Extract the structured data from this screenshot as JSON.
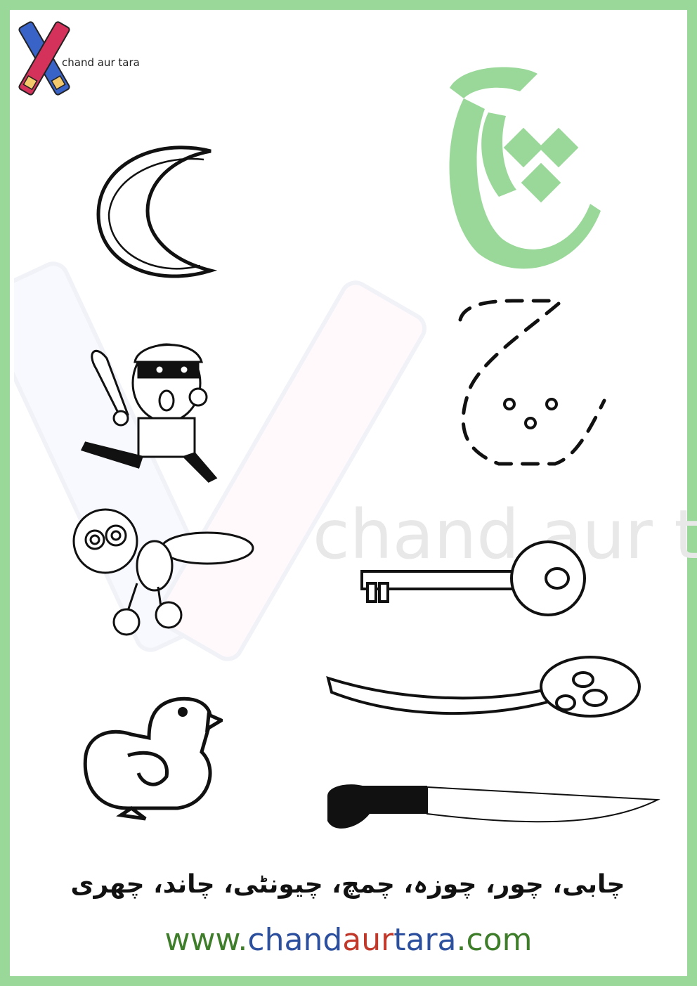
{
  "brand": {
    "name": "chand aur tara",
    "icon": "crossed-pencils-icon"
  },
  "watermark": {
    "text": "chand aur t"
  },
  "letter": {
    "glyph": "چ",
    "color": "#99d899"
  },
  "trace": {
    "glyph": "چ",
    "style": "dashed-outline"
  },
  "words": {
    "line": "چابی، چور، چوزہ، چمچ، چیونٹی، چاند، چھری"
  },
  "website": {
    "prefix": "www.",
    "part1": "chand",
    "part2": "aur",
    "part3": "tara",
    "suffix": ".com"
  },
  "colors": {
    "border": "#99d899",
    "url_green": "#3e7d2a",
    "url_blue": "#2c4f9e",
    "url_red": "#c0392b"
  },
  "pictures": [
    "moon-icon",
    "thief-icon",
    "ant-icon",
    "chick-icon",
    "key-icon",
    "spoon-icon",
    "knife-icon"
  ]
}
